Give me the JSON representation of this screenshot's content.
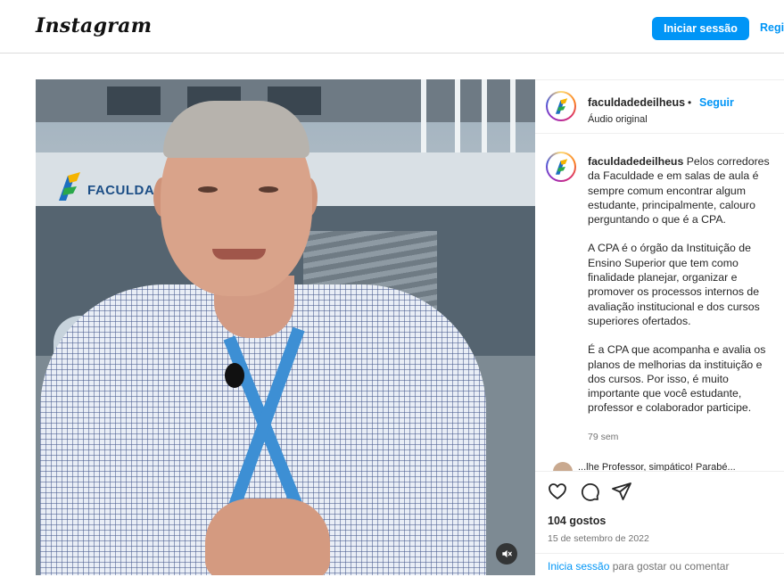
{
  "header": {
    "logo_text": "Instagram",
    "login_button": "Iniciar sessão",
    "register_link": "Regi"
  },
  "post": {
    "author": {
      "username": "faculdadedeilheus",
      "separator": "•",
      "follow_label": "Seguir",
      "audio_label": "Áudio original"
    },
    "media": {
      "sign_text": "FACULDA",
      "mute_icon": "speaker-muted-icon"
    },
    "caption": {
      "username": "faculdadedeilheus",
      "paragraph1": "Pelos corredores da Faculdade e em salas de aula é sempre comum encontrar algum estudante, principalmente, calouro perguntando o que é a CPA.",
      "paragraph2": "A CPA é o órgão da Instituição de Ensino Superior que tem como finalidade planejar, organizar e promover os processos internos de avaliação institucional e dos cursos superiores ofertados.",
      "paragraph3": "É a CPA que acompanha e avalia os planos de melhorias da instituição e dos cursos. Por isso, é muito importante que você estudante, professor e colaborador participe.",
      "age": "79 sem"
    },
    "comment_peek": "...lhe Professor, simpático! Parabé...",
    "actions": {
      "like_icon": "heart-icon",
      "comment_icon": "comment-icon",
      "share_icon": "paper-plane-icon"
    },
    "likes": "104 gostos",
    "date": "15 de setembro de 2022",
    "login_prompt": {
      "link": "Inicia sessão",
      "rest": " para gostar ou comentar"
    }
  },
  "colors": {
    "accent": "#0095f6",
    "text": "#262626",
    "muted": "#737373",
    "border": "#dbdbdb"
  }
}
